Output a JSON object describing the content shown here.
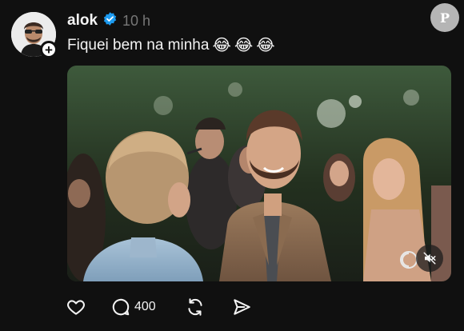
{
  "post": {
    "username": "alok",
    "verified": true,
    "timestamp": "10 h",
    "caption": "Fiquei bem na minha",
    "emojis": [
      "😂",
      "😂",
      "😂"
    ],
    "follow_symbol": "+"
  },
  "actions": {
    "like_icon": "heart-icon",
    "reply_count": "400",
    "repost_icon": "repost-icon",
    "share_icon": "send-icon"
  },
  "media": {
    "type": "video",
    "muted": true
  },
  "site_badge": {
    "mark": "P"
  },
  "colors": {
    "background": "#101010",
    "verified": "#1d9bf0",
    "text": "#f3f3f3",
    "muted_text": "#777777"
  }
}
